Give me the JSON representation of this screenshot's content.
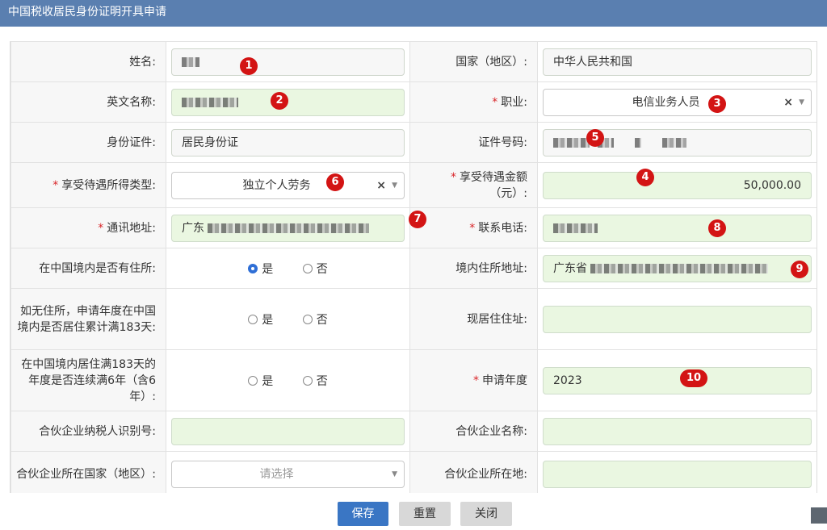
{
  "window": {
    "title": "中国税收居民身份证明开具申请"
  },
  "form": {
    "name_label": "姓名:",
    "country_label": "国家（地区）:",
    "country_value": "中华人民共和国",
    "english_name_label": "英文名称:",
    "occupation_label": "职业:",
    "occupation_value": "电信业务人员",
    "id_type_label": "身份证件:",
    "id_type_value": "居民身份证",
    "id_number_label": "证件号码:",
    "income_type_label": "享受待遇所得类型:",
    "income_type_value": "独立个人劳务",
    "amount_label_line1": "享受待遇金额",
    "amount_label_line2": "（元）:",
    "amount_value": "50,000.00",
    "address_label": "通讯地址:",
    "address_prefix": "广东",
    "phone_label": "联系电话:",
    "domicile_label": "在中国境内是否有住所:",
    "domicile_address_label": "境内住所地址:",
    "domicile_address_prefix": "广东省",
    "no_domicile_label": "如无住所，申请年度在中国境内是否居住累计满183天:",
    "current_address_label": "现居住住址:",
    "six_years_label": "在中国境内居住满183天的年度是否连续满6年（含6年）:",
    "apply_year_label": "申请年度",
    "apply_year_value": "2023",
    "partner_tin_label": "合伙企业纳税人识别号:",
    "partner_name_label": "合伙企业名称:",
    "partner_country_label": "合伙企业所在国家（地区）:",
    "partner_country_placeholder": "请选择",
    "partner_location_label": "合伙企业所在地:",
    "yes": "是",
    "no": "否",
    "required_mark": "*",
    "clear_glyph": "×",
    "caret_glyph": "▼"
  },
  "radios": {
    "domicile_selected": "yes",
    "no_domicile_selected": "none",
    "six_years_selected": "none"
  },
  "markers": [
    "1",
    "2",
    "3",
    "4",
    "5",
    "6",
    "7",
    "8",
    "9",
    "10"
  ],
  "buttons": {
    "save": "保存",
    "reset": "重置",
    "close": "关闭"
  },
  "colors": {
    "header": "#5a7fb0",
    "field_green": "#eaf7e1",
    "required": "#d9262a",
    "marker": "#d31414",
    "primary_button": "#3a76c4"
  }
}
